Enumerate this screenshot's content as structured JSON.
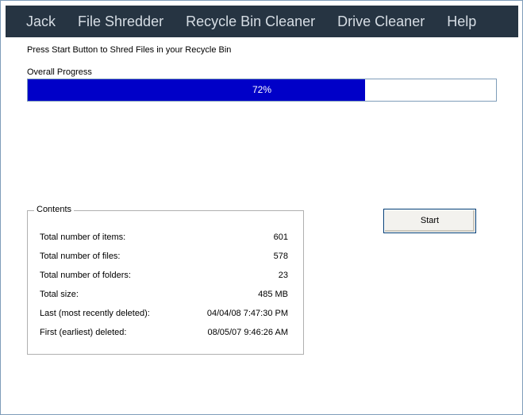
{
  "menu": {
    "items": [
      "Jack",
      "File Shredder",
      "Recycle Bin Cleaner",
      "Drive Cleaner",
      "Help"
    ]
  },
  "instruction": "Press Start Button to Shred Files in your Recycle Bin",
  "progress": {
    "label": "Overall Progress",
    "percent_text": "72%",
    "value": 0.72
  },
  "contents": {
    "title": "Contents",
    "rows": [
      {
        "label": "Total number of items:",
        "value": "601"
      },
      {
        "label": "Total number of files:",
        "value": "578"
      },
      {
        "label": "Total number of folders:",
        "value": "23"
      },
      {
        "label": "Total size:",
        "value": "485 MB"
      },
      {
        "label": "Last (most recently deleted):",
        "value": "04/04/08 7:47:30 PM"
      },
      {
        "label": "First (earliest) deleted:",
        "value": "08/05/07 9:46:26 AM"
      }
    ]
  },
  "start_button": {
    "label": "Start"
  },
  "colors": {
    "menubar": "#263442",
    "progress_fill": "#0000c8"
  }
}
